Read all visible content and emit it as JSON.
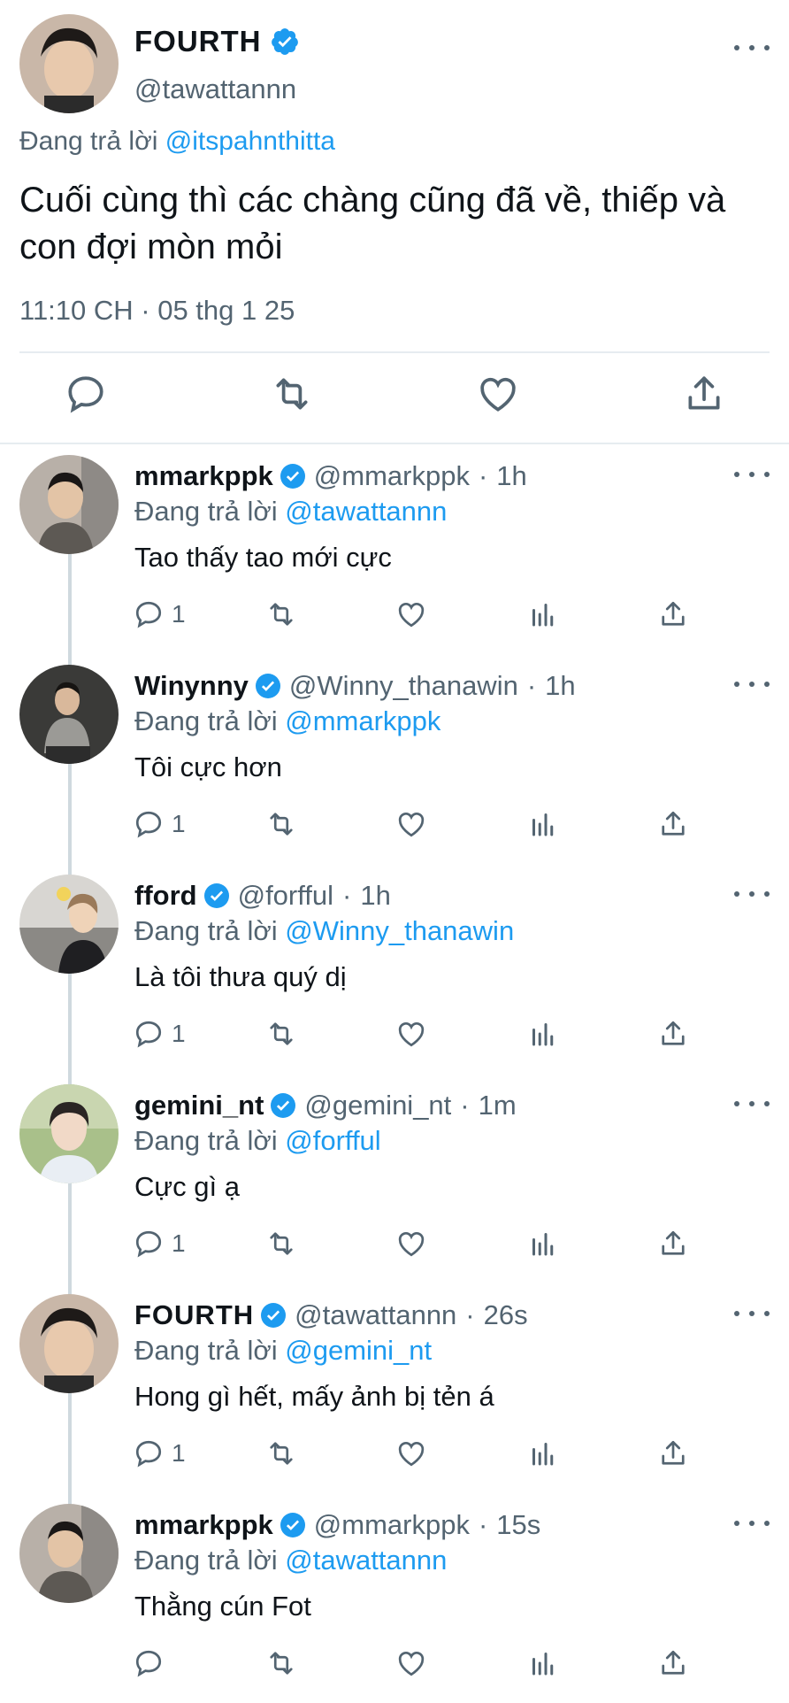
{
  "colors": {
    "accent": "#1d9bf0",
    "text": "#0f1419",
    "secondary": "#536471",
    "divider": "#e6ecf0",
    "thread_line": "#cfd9de"
  },
  "main_tweet": {
    "name": "FOURTH",
    "handle": "@tawattannn",
    "replying_label": "Đang trả lời",
    "replying_to": "@itspahnthitta",
    "text": "Cuối cùng thì các chàng cũng đã về, thiếp và con đợi mòn mỏi",
    "timestamp": "11:10 CH · 05 thg 1 25",
    "actions": [
      "reply-icon",
      "retweet-icon",
      "like-icon",
      "share-icon"
    ]
  },
  "replies": [
    {
      "name": "mmarkppk",
      "handle": "@mmarkppk",
      "time": "1h",
      "replying_label": "Đang trả lời",
      "replying_to": "@tawattannn",
      "text": "Tao thấy tao mới cực",
      "reply_count": "1"
    },
    {
      "name": "Winynny",
      "handle": "@Winny_thanawin",
      "time": "1h",
      "replying_label": "Đang trả lời",
      "replying_to": "@mmarkppk",
      "text": "Tôi cực hơn",
      "reply_count": "1"
    },
    {
      "name": "fford",
      "handle": "@forfful",
      "time": "1h",
      "replying_label": "Đang trả lời",
      "replying_to": "@Winny_thanawin",
      "text": "Là tôi thưa quý dị",
      "reply_count": "1"
    },
    {
      "name": "gemini_nt",
      "handle": "@gemini_nt",
      "time": "1m",
      "replying_label": "Đang trả lời",
      "replying_to": "@forfful",
      "text": "Cực gì ạ",
      "reply_count": "1"
    },
    {
      "name": "FOURTH",
      "handle": "@tawattannn",
      "time": "26s",
      "replying_label": "Đang trả lời",
      "replying_to": "@gemini_nt",
      "text": "Hong gì hết, mấy ảnh bị tẻn á",
      "reply_count": "1"
    },
    {
      "name": "mmarkppk",
      "handle": "@mmarkppk",
      "time": "15s",
      "replying_label": "Đang trả lời",
      "replying_to": "@tawattannn",
      "text": "Thằng cún Fot",
      "reply_count": ""
    }
  ],
  "dot_separator": "·"
}
